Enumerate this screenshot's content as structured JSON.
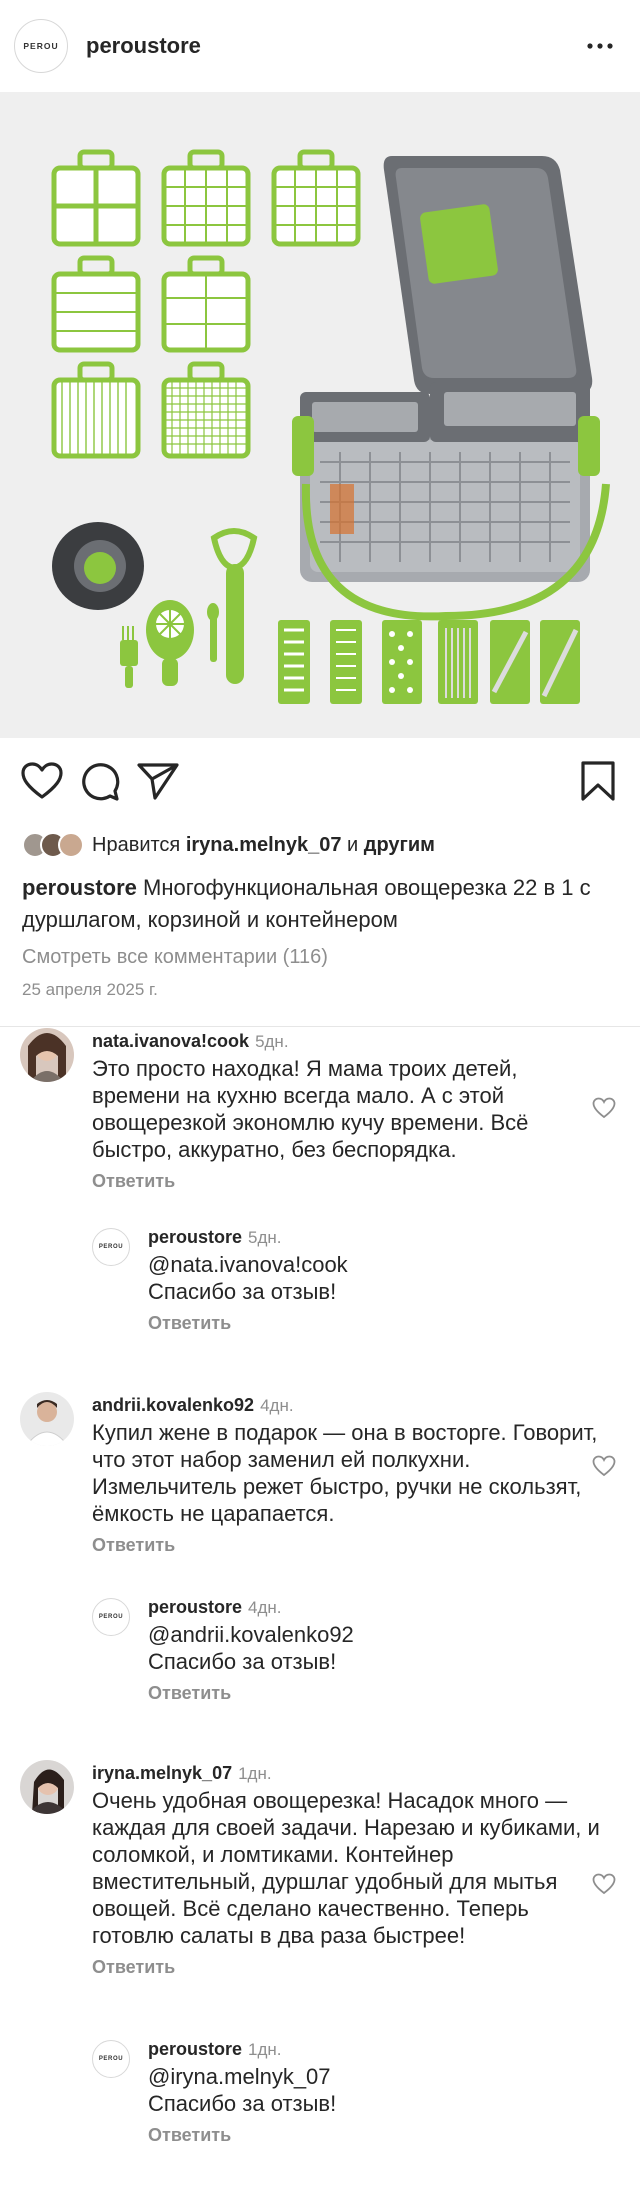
{
  "header": {
    "logo_text": "PEROU",
    "username": "peroustore",
    "more_icon": "more-horizontal-icon"
  },
  "post": {
    "image_description_icon": "vegetable-slicer-product-photo",
    "liked_by_prefix": "Нравится",
    "liked_by_user": "iryna.melnyk_07",
    "liked_by_join": "и",
    "liked_by_suffix": "другим",
    "caption_user": "peroustore",
    "caption_text": "Многофункциональная овощерезка 22 в 1 с дуршлагом, корзиной и контейнером",
    "view_all_comments": "Смотреть все комментарии (116)",
    "date": "25 апреля 2025 г."
  },
  "actions": {
    "like_icon": "heart-icon",
    "comment_icon": "comment-bubble-icon",
    "share_icon": "paper-plane-icon",
    "save_icon": "bookmark-icon"
  },
  "comments": [
    {
      "user": "nata.ivanova!cook",
      "ago": "5дн.",
      "text": "Это просто находка! Я мама троих детей, времени на кухню всегда мало. А с этой овощерезкой экономлю кучу времени. Всё быстро, аккуратно, без беспорядка.",
      "reply_label": "Ответить",
      "reply": {
        "user": "peroustore",
        "ago": "5дн.",
        "mention": "@nata.ivanova!cook",
        "text": "Спасибо за отзыв!",
        "reply_label": "Ответить"
      }
    },
    {
      "user": "andrii.kovalenko92",
      "ago": "4дн.",
      "text": "Купил жене в подарок — она в восторге. Говорит, что этот набор заменил ей полкухни. Измельчитель режет быстро, ручки не скользят, ёмкость не царапается.",
      "reply_label": "Ответить",
      "reply": {
        "user": "peroustore",
        "ago": "4дн.",
        "mention": "@andrii.kovalenko92",
        "text": "Спасибо за отзыв!",
        "reply_label": "Ответить"
      }
    },
    {
      "user": "iryna.melnyk_07",
      "ago": "1дн.",
      "text": "Очень удобная овощерезка! Насадок много — каждая для своей задачи. Нарезаю и кубиками, и соломкой, и ломтиками. Контейнер вместительный, дуршлаг удобный для мытья овощей. Всё сделано качественно. Теперь готовлю салаты в два раза быстрее!",
      "reply_label": "Ответить",
      "reply": {
        "user": "peroustore",
        "ago": "1дн.",
        "mention": "@iryna.melnyk_07",
        "text": "Спасибо за отзыв!",
        "reply_label": "Ответить"
      }
    }
  ],
  "colors": {
    "accent_green": "#8cc63f",
    "product_gray": "#6b6e73",
    "mention_blue": "#2b4a7a",
    "muted_text": "#8e8e8e"
  }
}
